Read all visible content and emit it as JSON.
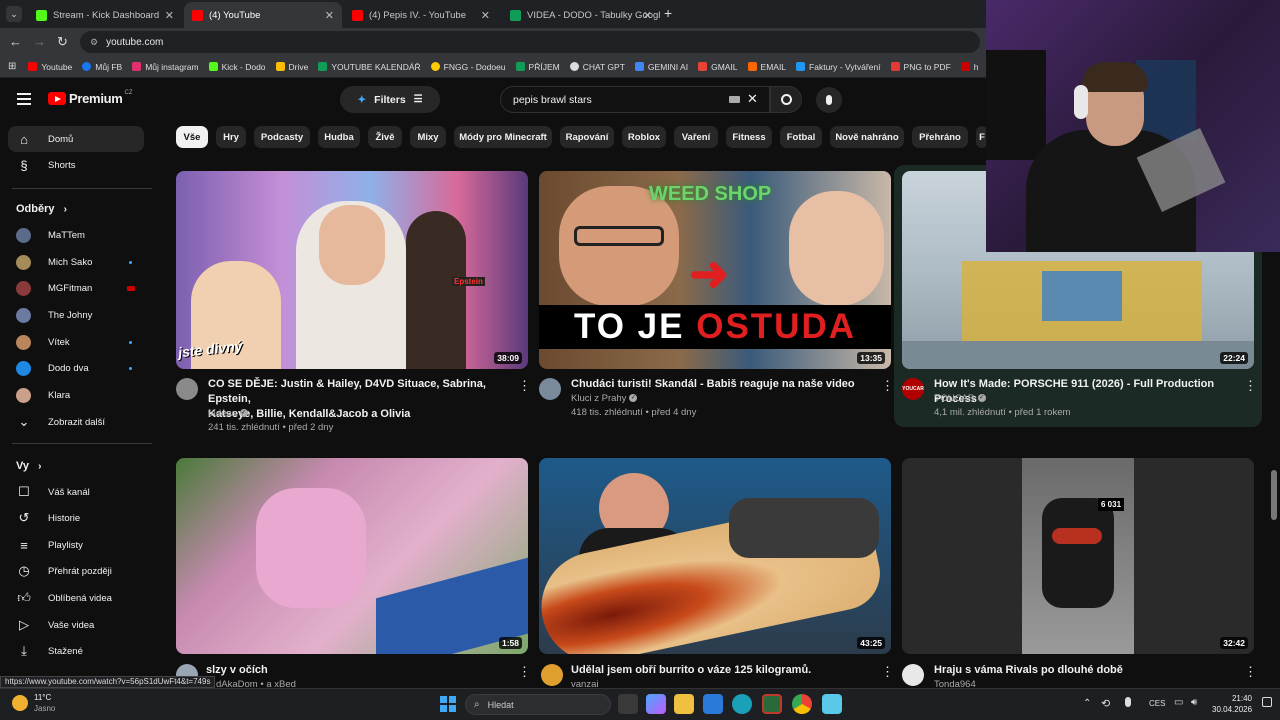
{
  "browser": {
    "tabs": [
      {
        "label": "Stream - Kick Dashboard",
        "color": "#53fc18"
      },
      {
        "label": "(4) YouTube",
        "color": "#ff0000"
      },
      {
        "label": "(4) Pepis IV. - YouTube",
        "color": "#ff0000"
      },
      {
        "label": "VIDEA - DODO - Tabulky Googl",
        "color": "#0f9d58"
      }
    ],
    "url": "youtube.com",
    "bookmarks": [
      {
        "label": "Youtube",
        "color": "#ff0000"
      },
      {
        "label": "Můj FB",
        "color": "#1877f2"
      },
      {
        "label": "Můj instagram",
        "color": "#e1306c"
      },
      {
        "label": "Kick - Dodo",
        "color": "#53fc18"
      },
      {
        "label": "Drive",
        "color": "#fbbc04"
      },
      {
        "label": "YOUTUBE KALENDÁŘ",
        "color": "#0f9d58"
      },
      {
        "label": "FNGG - Dodoeu",
        "color": "#ffcc00"
      },
      {
        "label": "PŘÍJEM",
        "color": "#0f9d58"
      },
      {
        "label": "CHAT GPT",
        "color": "#dddddd"
      },
      {
        "label": "GEMINI AI",
        "color": "#4285f4"
      },
      {
        "label": "GMAIL",
        "color": "#ea4335"
      },
      {
        "label": "EMAIL",
        "color": "#ff6600"
      },
      {
        "label": "Faktury - Vytváření",
        "color": "#2196f3"
      },
      {
        "label": "PNG to PDF",
        "color": "#e53935"
      },
      {
        "label": "h",
        "color": "#cc0000"
      }
    ]
  },
  "youtube": {
    "logo_text": "Premium",
    "region": "CZ",
    "filters_label": "Filters",
    "search_value": "pepis brawl stars",
    "chips": [
      "Vše",
      "Hry",
      "Podcasty",
      "Hudba",
      "Živě",
      "Mixy",
      "Módy pro Minecraft",
      "Rapování",
      "Roblox",
      "Vaření",
      "Fitness",
      "Fotbal",
      "Nově nahráno",
      "Přehráno",
      "F"
    ],
    "sidebar": {
      "home": "Domů",
      "shorts": "Shorts",
      "subs_header": "Odběry",
      "subs": [
        {
          "name": "MaTTem",
          "color": "#5b6b8c",
          "dot": false
        },
        {
          "name": "Mich Sako",
          "color": "#a58a5a",
          "dot": true
        },
        {
          "name": "MGFitman",
          "color": "#8a3a3a",
          "dot": true
        },
        {
          "name": "The Johny",
          "color": "#6a7aa0",
          "dot": false
        },
        {
          "name": "Vítek",
          "color": "#b8865a",
          "dot": true
        },
        {
          "name": "Dodo dva",
          "color": "#1e88e5",
          "dot": true
        },
        {
          "name": "Klara",
          "color": "#c9a08a",
          "dot": false
        }
      ],
      "show_more": "Zobrazit další",
      "you_header": "Vy",
      "you_items": [
        "Váš kanál",
        "Historie",
        "Playlisty",
        "Přehrát později",
        "Oblíbená videa",
        "Vaše videa",
        "Stažené"
      ]
    },
    "videos": [
      {
        "title_1": "CO SE DĚJE: Justin & Hailey, D4VD Situace, Sabrina, Epstein,",
        "title_2": "Katseye, Billie, Kendall&Jacob a Olivia",
        "channel": "tadeas",
        "meta": "241 tis. zhlédnutí • před 2 dny",
        "duration": "38:09",
        "thumb_text": "jste divný",
        "thumb_label": "Epstein"
      },
      {
        "title_1": "Chudáci turisti! Skandál - Babiš reaguje na naše video",
        "title_2": "",
        "channel": "Kluci z Prahy",
        "meta": "418 tis. zhlédnutí • před 4 dny",
        "duration": "13:35",
        "thumb_text_white": "TO JE ",
        "thumb_text_red": "OSTUDA",
        "thumb_sign": "WEED SHOP"
      },
      {
        "title_1": "How It's Made: PORSCHE 911 (2026) - Full Production Process",
        "title_2": "",
        "channel": "YOUCAR",
        "meta": "4,1 mil. zhlédnutí • před 1 rokem",
        "duration": "22:24",
        "channel_badge": "YOUCAR"
      },
      {
        "title_1": "slzy v očích",
        "title_2": "",
        "channel": "dAkaDom • a xBed",
        "meta": "",
        "duration": "1:58"
      },
      {
        "title_1": "Udělal jsem obří burrito o váze 125 kilogramů.",
        "title_2": "",
        "channel": "vanzai",
        "meta": "",
        "duration": "43:25"
      },
      {
        "title_1": "Hraju s vámа Rivals po dlouhé době",
        "title_2": "",
        "channel": "Tonda964",
        "meta": "",
        "duration": "32:42",
        "thumb_badge": "6 031"
      }
    ]
  },
  "status_url": "https://www.youtube.com/watch?v=56pS1dUwFt4&t=749s",
  "taskbar": {
    "weather_temp": "11°C",
    "weather_desc": "Jasno",
    "search_placeholder": "Hledat",
    "lang": "CES",
    "time": "21:40",
    "date": "30.04.2026"
  }
}
